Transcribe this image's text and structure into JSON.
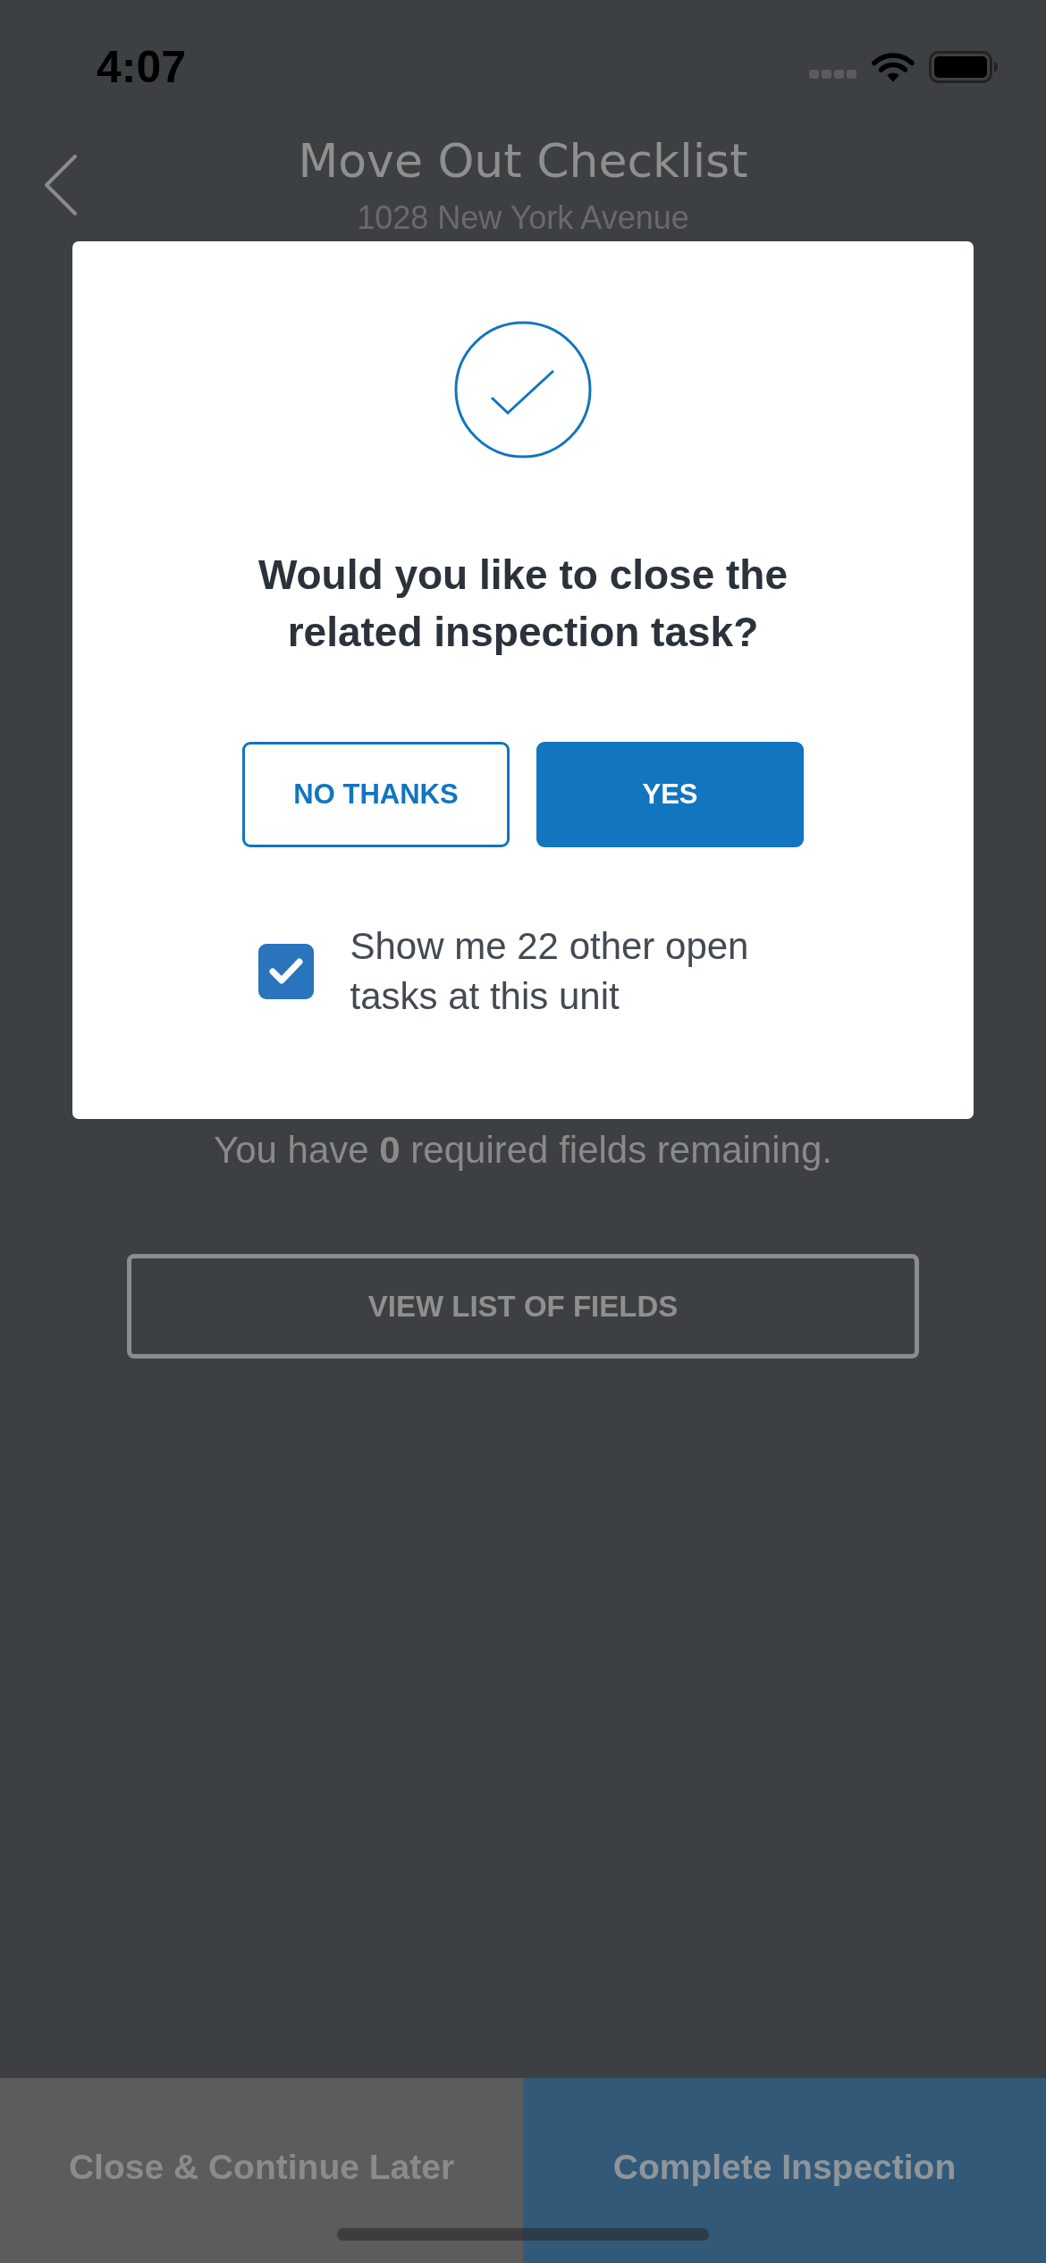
{
  "status_bar": {
    "time": "4:07"
  },
  "header": {
    "title": "Move Out Checklist",
    "subtitle": "1028 New York Avenue"
  },
  "content": {
    "remaining_text": "You have **0** required fields remaining.",
    "view_fields_button": "VIEW LIST OF FIELDS"
  },
  "dialog": {
    "question": "Would you like to close the related inspection task?",
    "buttons": [
      {
        "label": "NO THANKS",
        "kind": "outline"
      },
      {
        "label": "YES",
        "kind": "filled"
      }
    ],
    "checkbox": {
      "label": "Show me 22 other open tasks at this unit",
      "checked": true
    }
  },
  "footer": {
    "buttons": [
      {
        "label": "Close & Continue Later",
        "kind": "secondary"
      },
      {
        "label": "Complete Inspection",
        "kind": "primary"
      }
    ]
  }
}
